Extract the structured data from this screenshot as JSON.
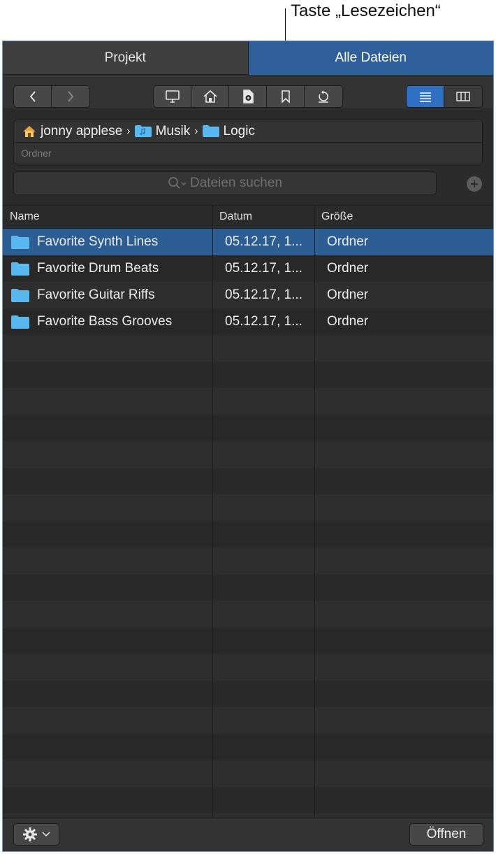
{
  "callout": {
    "label": "Taste „Lesezeichen“"
  },
  "tabs": [
    {
      "label": "Projekt",
      "active": false
    },
    {
      "label": "Alle Dateien",
      "active": true
    }
  ],
  "toolbar": {
    "nav": [
      "chevron-left-icon",
      "chevron-right-icon"
    ],
    "locations": [
      "desktop-icon",
      "home-icon",
      "drive-icon",
      "bookmark-icon",
      "recent-icon"
    ],
    "views": [
      {
        "icon": "list-view-icon",
        "active": true
      },
      {
        "icon": "column-view-icon",
        "active": false
      }
    ]
  },
  "path": {
    "crumbs": [
      {
        "label": "jonny applese",
        "icon": "home-folder-icon"
      },
      {
        "label": "Musik",
        "icon": "music-folder-icon"
      },
      {
        "label": "Logic",
        "icon": "folder-icon"
      }
    ],
    "separator": "›",
    "kind": "Ordner"
  },
  "search": {
    "placeholder": "Dateien suchen"
  },
  "table": {
    "columns": [
      "Name",
      "Datum",
      "Größe"
    ],
    "rows": [
      {
        "name": "Favorite Synth Lines",
        "date": "05.12.17, 1...",
        "size": "Ordner",
        "selected": true
      },
      {
        "name": "Favorite Drum Beats",
        "date": "05.12.17, 1...",
        "size": "Ordner",
        "selected": false
      },
      {
        "name": "Favorite Guitar Riffs",
        "date": "05.12.17, 1...",
        "size": "Ordner",
        "selected": false
      },
      {
        "name": "Favorite Bass Grooves",
        "date": "05.12.17, 1...",
        "size": "Ordner",
        "selected": false
      }
    ]
  },
  "bottom": {
    "open_label": "Öffnen"
  },
  "colors": {
    "accent": "#2f5f9a",
    "selection": "#2c5d93",
    "folder": "#5ab8f0",
    "panel": "#2b2b2b"
  }
}
